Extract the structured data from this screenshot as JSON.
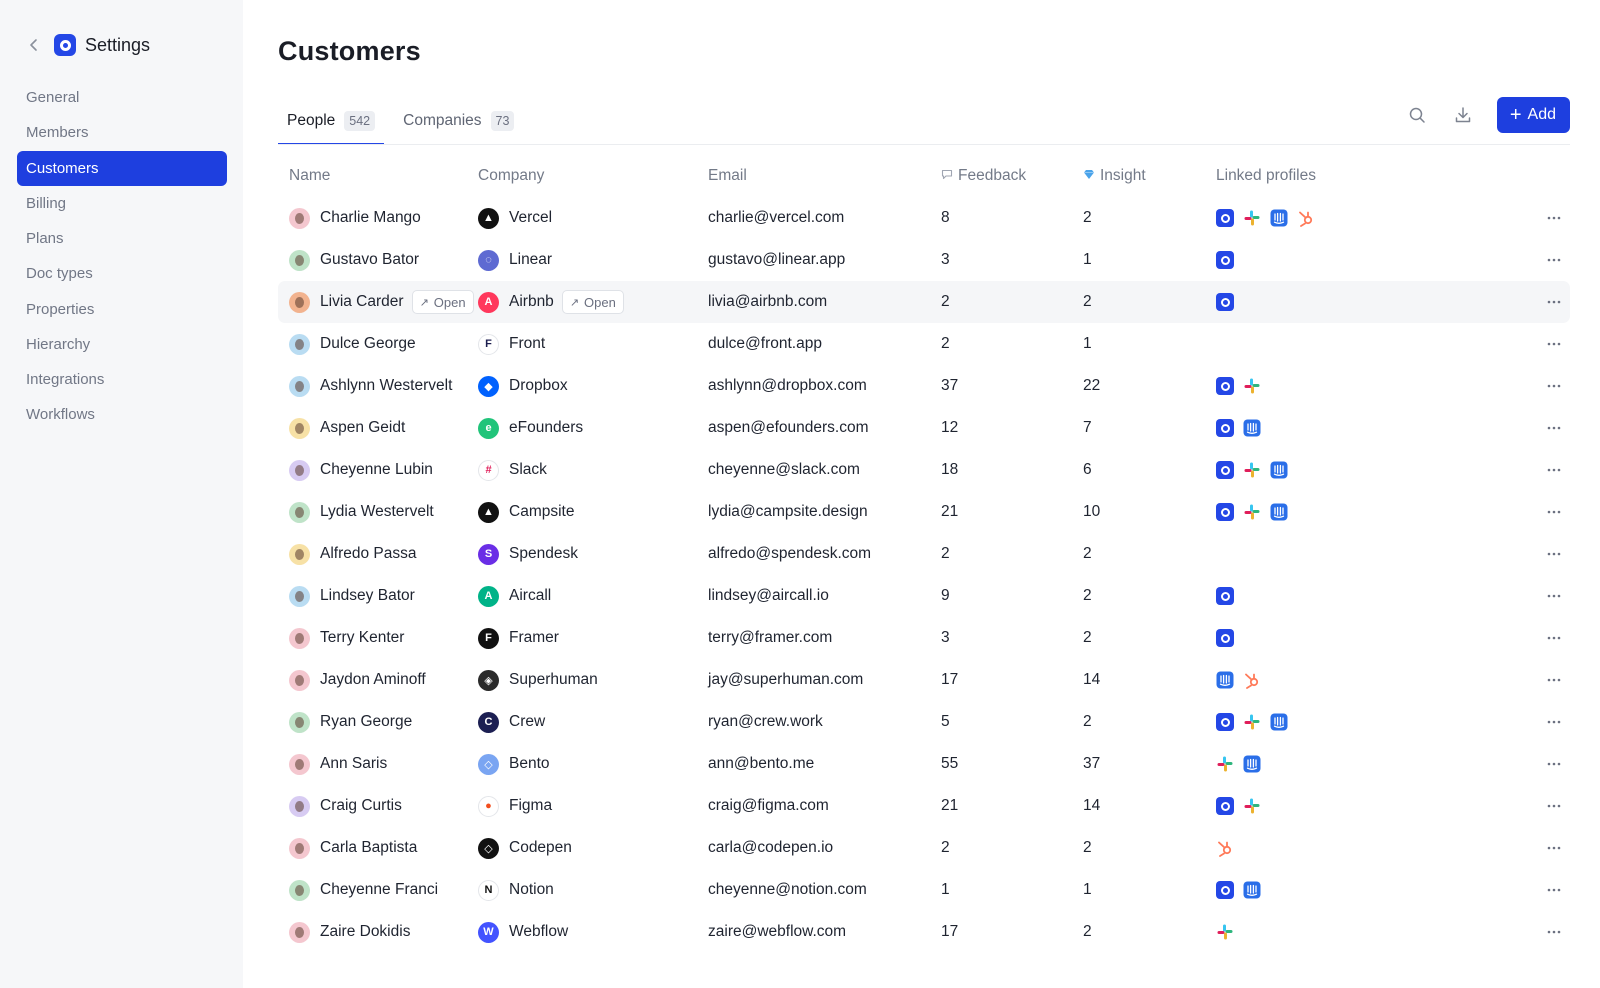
{
  "sidebar": {
    "title": "Settings",
    "items": [
      {
        "label": "General",
        "active": false
      },
      {
        "label": "Members",
        "active": false
      },
      {
        "label": "Customers",
        "active": true
      },
      {
        "label": "Billing",
        "active": false
      },
      {
        "label": "Plans",
        "active": false
      },
      {
        "label": "Doc types",
        "active": false
      },
      {
        "label": "Properties",
        "active": false
      },
      {
        "label": "Hierarchy",
        "active": false
      },
      {
        "label": "Integrations",
        "active": false
      },
      {
        "label": "Workflows",
        "active": false
      }
    ]
  },
  "main": {
    "title": "Customers",
    "tabs": [
      {
        "label": "People",
        "count": "542",
        "active": true
      },
      {
        "label": "Companies",
        "count": "73",
        "active": false
      }
    ],
    "add_label": "Add"
  },
  "table": {
    "headers": {
      "name": "Name",
      "company": "Company",
      "email": "Email",
      "feedback": "Feedback",
      "insight": "Insight",
      "linked": "Linked profiles"
    },
    "open_label": "Open",
    "rows": [
      {
        "name": "Charlie Mango",
        "company": "Vercel",
        "email": "charlie@vercel.com",
        "feedback": "8",
        "insight": "2",
        "profiles": [
          "harvestr",
          "slack",
          "intercom",
          "hubspot"
        ],
        "avatar_color": "#f4c7cf",
        "logo_color": "#111111",
        "logo_glyph": "▲"
      },
      {
        "name": "Gustavo Bator",
        "company": "Linear",
        "email": "gustavo@linear.app",
        "feedback": "3",
        "insight": "1",
        "profiles": [
          "harvestr"
        ],
        "avatar_color": "#bfe3c8",
        "logo_color": "#5e6ad2",
        "logo_glyph": "◌"
      },
      {
        "name": "Livia Carder",
        "company": "Airbnb",
        "email": "livia@airbnb.com",
        "feedback": "2",
        "insight": "2",
        "profiles": [
          "harvestr"
        ],
        "avatar_color": "#f2b38f",
        "logo_color": "#ff385c",
        "logo_glyph": "A",
        "hover": true
      },
      {
        "name": "Dulce George",
        "company": "Front",
        "email": "dulce@front.app",
        "feedback": "2",
        "insight": "1",
        "profiles": [],
        "avatar_color": "#b9dcf2",
        "logo_color": "#ffffff",
        "logo_glyph": "F",
        "logo_text": "#1c1e4f"
      },
      {
        "name": "Ashlynn Westervelt",
        "company": "Dropbox",
        "email": "ashlynn@dropbox.com",
        "feedback": "37",
        "insight": "22",
        "profiles": [
          "harvestr",
          "slack"
        ],
        "avatar_color": "#b9dcf2",
        "logo_color": "#0061fe",
        "logo_glyph": "◆"
      },
      {
        "name": "Aspen Geidt",
        "company": "eFounders",
        "email": "aspen@efounders.com",
        "feedback": "12",
        "insight": "7",
        "profiles": [
          "harvestr",
          "intercom"
        ],
        "avatar_color": "#f7e1a6",
        "logo_color": "#21c47a",
        "logo_glyph": "e"
      },
      {
        "name": "Cheyenne Lubin",
        "company": "Slack",
        "email": "cheyenne@slack.com",
        "feedback": "18",
        "insight": "6",
        "profiles": [
          "harvestr",
          "slack",
          "intercom"
        ],
        "avatar_color": "#d7cbf2",
        "logo_color": "#ffffff",
        "logo_glyph": "#",
        "logo_text": "#e01e5a"
      },
      {
        "name": "Lydia Westervelt",
        "company": "Campsite",
        "email": "lydia@campsite.design",
        "feedback": "21",
        "insight": "10",
        "profiles": [
          "harvestr",
          "slack",
          "intercom"
        ],
        "avatar_color": "#bfe3c8",
        "logo_color": "#111111",
        "logo_glyph": "▲"
      },
      {
        "name": "Alfredo Passa",
        "company": "Spendesk",
        "email": "alfredo@spendesk.com",
        "feedback": "2",
        "insight": "2",
        "profiles": [],
        "avatar_color": "#f7e1a6",
        "logo_color": "#6a2ee6",
        "logo_glyph": "S"
      },
      {
        "name": "Lindsey Bator",
        "company": "Aircall",
        "email": "lindsey@aircall.io",
        "feedback": "9",
        "insight": "2",
        "profiles": [
          "harvestr"
        ],
        "avatar_color": "#b9dcf2",
        "logo_color": "#00b388",
        "logo_glyph": "A"
      },
      {
        "name": "Terry Kenter",
        "company": "Framer",
        "email": "terry@framer.com",
        "feedback": "3",
        "insight": "2",
        "profiles": [
          "harvestr"
        ],
        "avatar_color": "#f4c7cf",
        "logo_color": "#111111",
        "logo_glyph": "F"
      },
      {
        "name": "Jaydon Aminoff",
        "company": "Superhuman",
        "email": "jay@superhuman.com",
        "feedback": "17",
        "insight": "14",
        "profiles": [
          "intercom",
          "hubspot"
        ],
        "avatar_color": "#f4c7cf",
        "logo_color": "#2b2b2b",
        "logo_glyph": "◈"
      },
      {
        "name": "Ryan George",
        "company": "Crew",
        "email": "ryan@crew.work",
        "feedback": "5",
        "insight": "2",
        "profiles": [
          "harvestr",
          "slack",
          "intercom"
        ],
        "avatar_color": "#bfe3c8",
        "logo_color": "#1c1f52",
        "logo_glyph": "C"
      },
      {
        "name": "Ann Saris",
        "company": "Bento",
        "email": "ann@bento.me",
        "feedback": "55",
        "insight": "37",
        "profiles": [
          "slack",
          "intercom"
        ],
        "avatar_color": "#f4c7cf",
        "logo_color": "#7aa5f2",
        "logo_glyph": "◇"
      },
      {
        "name": "Craig Curtis",
        "company": "Figma",
        "email": "craig@figma.com",
        "feedback": "21",
        "insight": "14",
        "profiles": [
          "harvestr",
          "slack"
        ],
        "avatar_color": "#d7cbf2",
        "logo_color": "#ffffff",
        "logo_glyph": "●",
        "logo_text": "#f24e1e"
      },
      {
        "name": "Carla Baptista",
        "company": "Codepen",
        "email": "carla@codepen.io",
        "feedback": "2",
        "insight": "2",
        "profiles": [
          "hubspot"
        ],
        "avatar_color": "#f4c7cf",
        "logo_color": "#111111",
        "logo_glyph": "◇"
      },
      {
        "name": "Cheyenne Franci",
        "company": "Notion",
        "email": "cheyenne@notion.com",
        "feedback": "1",
        "insight": "1",
        "profiles": [
          "harvestr",
          "intercom"
        ],
        "avatar_color": "#bfe3c8",
        "logo_color": "#ffffff",
        "logo_glyph": "N",
        "logo_text": "#111111"
      },
      {
        "name": "Zaire Dokidis",
        "company": "Webflow",
        "email": "zaire@webflow.com",
        "feedback": "17",
        "insight": "2",
        "profiles": [
          "slack"
        ],
        "avatar_color": "#f4c7cf",
        "logo_color": "#4353ff",
        "logo_glyph": "W"
      }
    ]
  },
  "colors": {
    "accent": "#1e3fdf",
    "sidebar_bg": "#f6f7f9",
    "hover_row": "#f5f6f8",
    "hubspot": "#ff7a59"
  },
  "icons": {
    "back": "chevron-left-icon",
    "search": "search-icon",
    "download": "download-icon",
    "add": "plus-icon",
    "feedback": "speech-bubble-icon",
    "insight": "gem-icon",
    "more": "ellipsis-icon"
  }
}
